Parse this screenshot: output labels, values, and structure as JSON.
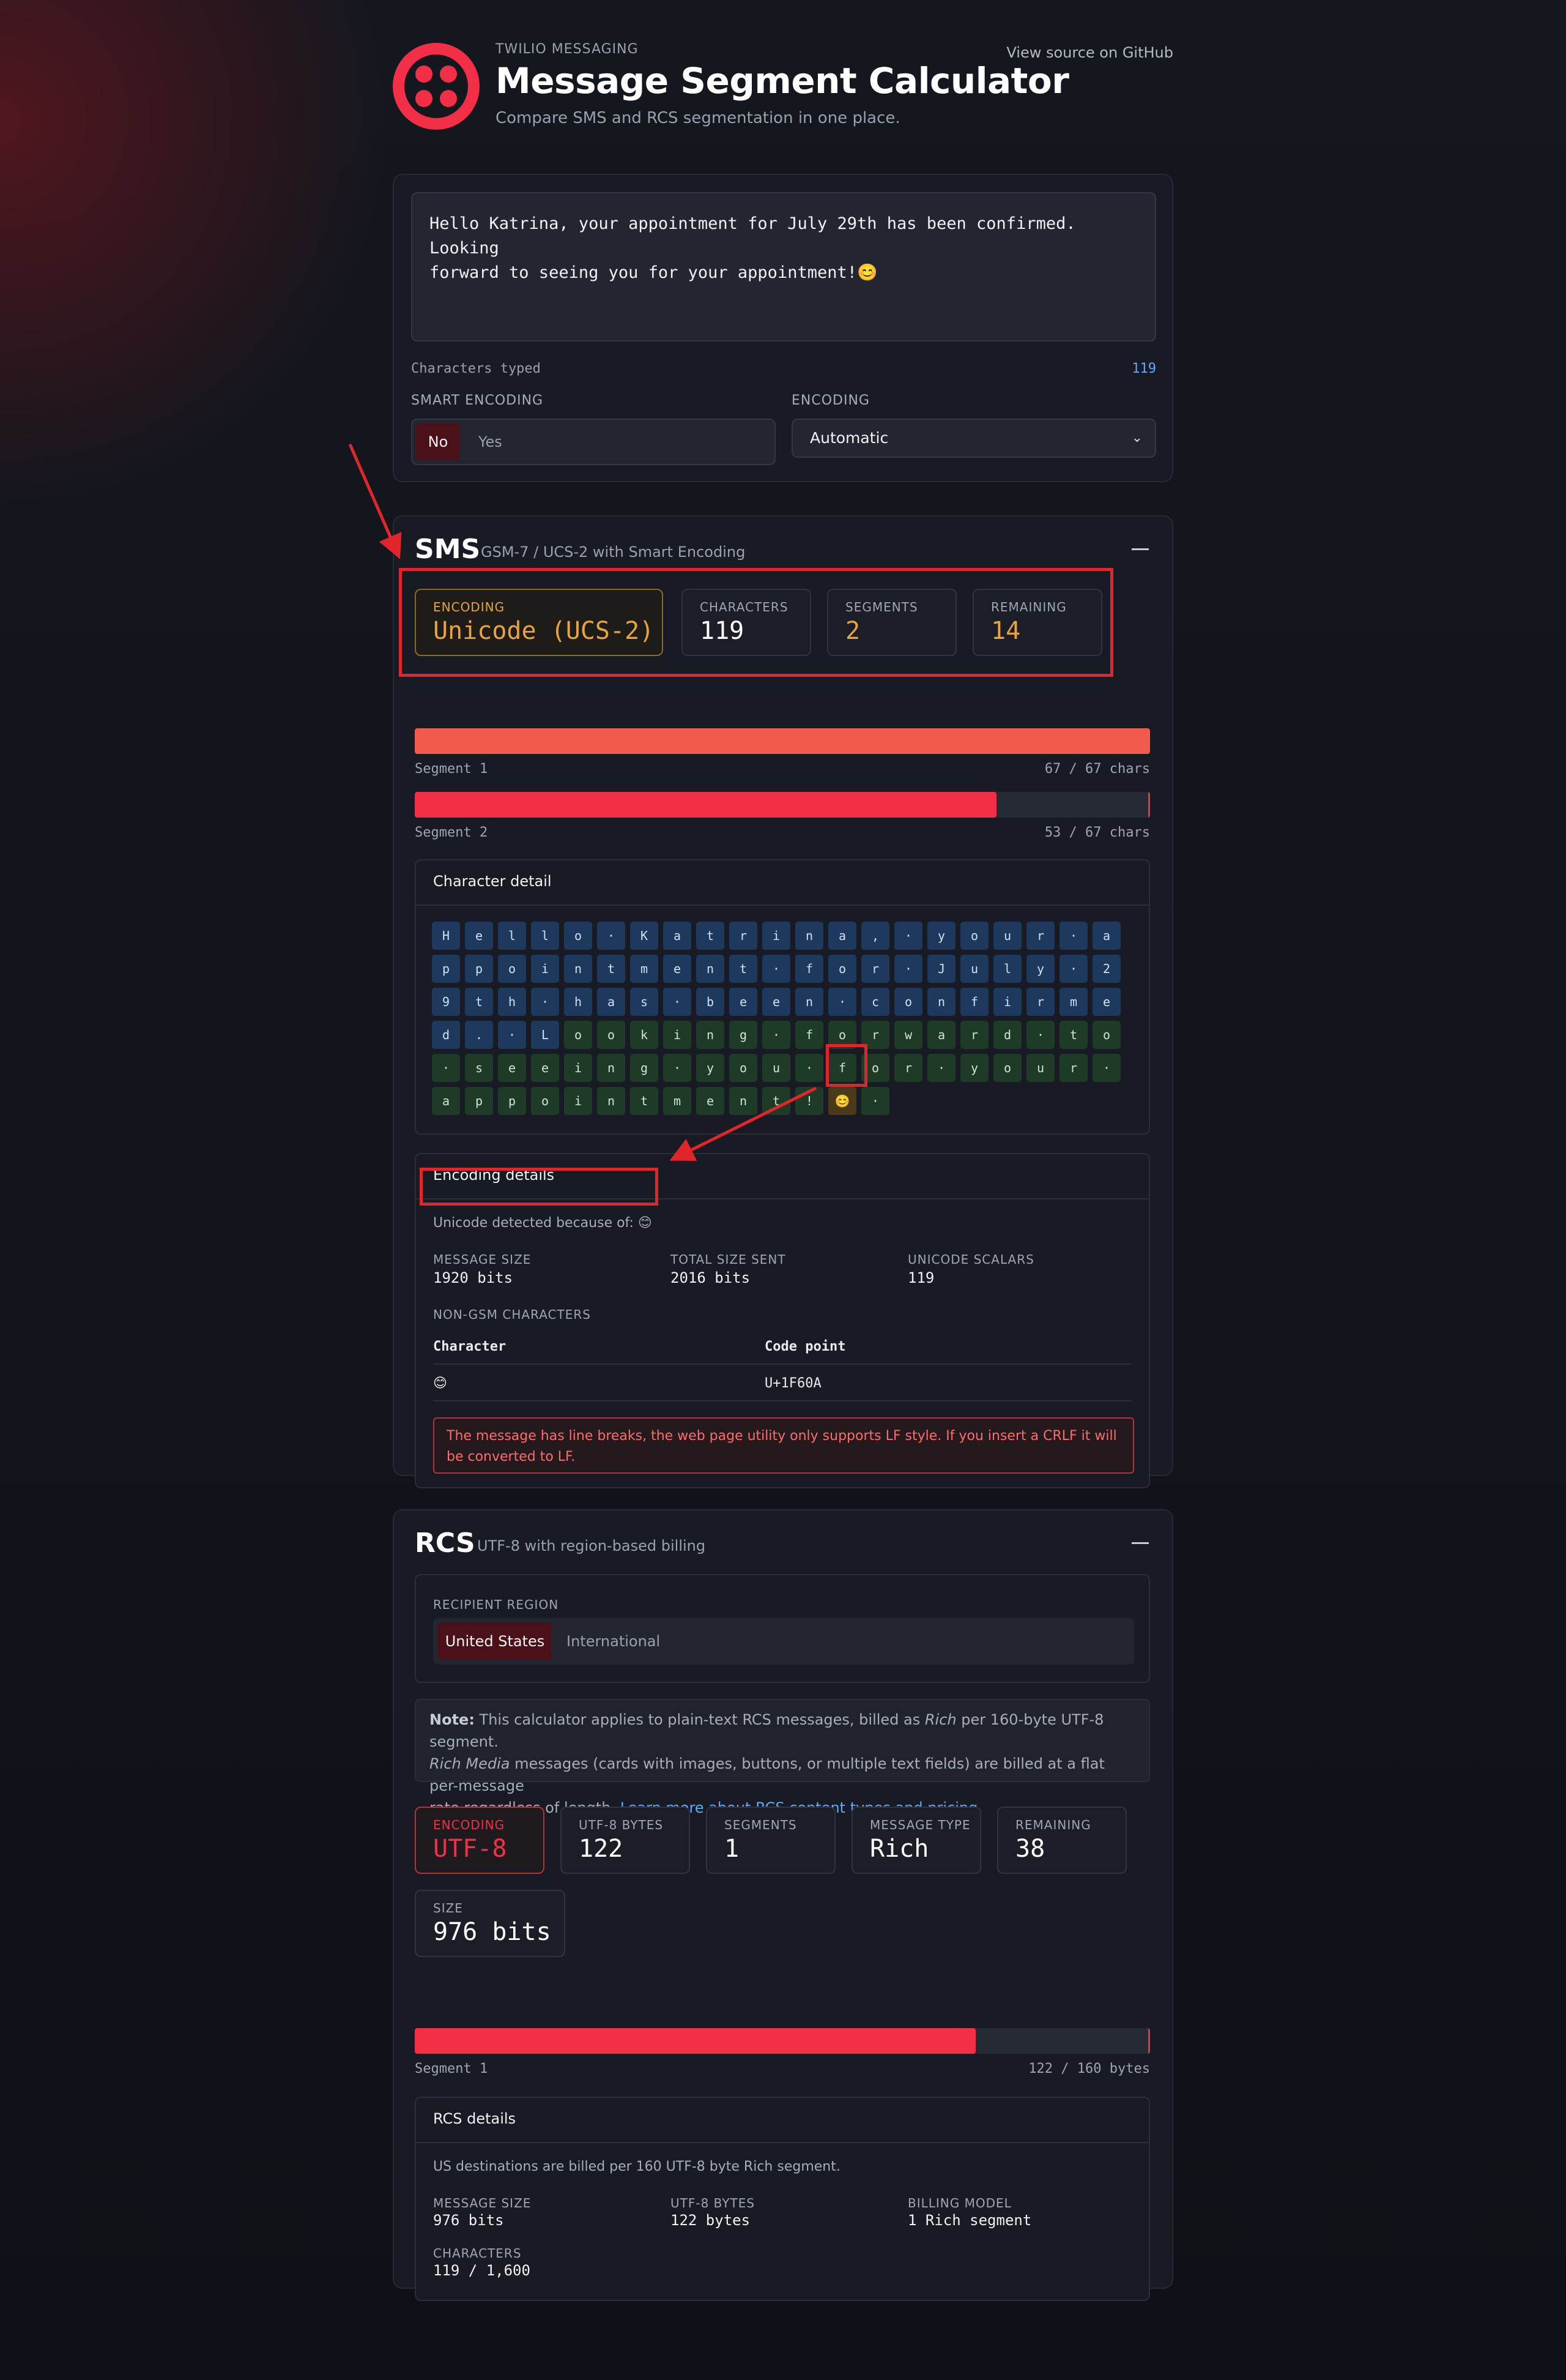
{
  "header": {
    "eyebrow": "TWILIO MESSAGING",
    "title": "Message Segment Calculator",
    "subtitle": "Compare SMS and RCS segmentation in one place.",
    "github_link": "View source on GitHub"
  },
  "input": {
    "message_line1": "Hello Katrina, your appointment for July 29th has been confirmed. Looking",
    "message_line2": "forward to seeing you for your appointment!😊",
    "chars_typed_label": "Characters typed",
    "chars_typed_value": "119",
    "smart_encoding_label": "SMART ENCODING",
    "smart_no": "No",
    "smart_yes": "Yes",
    "encoding_label": "ENCODING",
    "encoding_value": "Automatic"
  },
  "sms": {
    "title": "SMS",
    "subtitle": "GSM-7 / UCS-2 with Smart Encoding",
    "stats": {
      "encoding_k": "ENCODING",
      "encoding_v": "Unicode (UCS-2)",
      "characters_k": "CHARACTERS",
      "characters_v": "119",
      "segments_k": "SEGMENTS",
      "segments_v": "2",
      "remaining_k": "REMAINING",
      "remaining_v": "14"
    },
    "segments": [
      {
        "label": "Segment 1",
        "count": "67 / 67 chars",
        "fill_fraction": 1.0
      },
      {
        "label": "Segment 2",
        "count": "53 / 67 chars",
        "fill_fraction": 0.791
      }
    ],
    "char_detail_title": "Character detail",
    "char_rows": [
      [
        "H",
        "e",
        "l",
        "l",
        "o",
        "·",
        "K",
        "a",
        "t",
        "r",
        "i",
        "n",
        "a",
        ",",
        "·",
        "y",
        "o",
        "u",
        "r",
        "·",
        "a"
      ],
      [
        "p",
        "p",
        "o",
        "i",
        "n",
        "t",
        "m",
        "e",
        "n",
        "t",
        "·",
        "f",
        "o",
        "r",
        "·",
        "J",
        "u",
        "l",
        "y",
        "·",
        "2"
      ],
      [
        "9",
        "t",
        "h",
        "·",
        "h",
        "a",
        "s",
        "·",
        "b",
        "e",
        "e",
        "n",
        "·",
        "c",
        "o",
        "n",
        "f",
        "i",
        "r",
        "m",
        "e"
      ],
      [
        "d",
        ".",
        "·",
        "L",
        "o",
        "o",
        "k",
        "i",
        "n",
        "g",
        "·",
        "f",
        "o",
        "r",
        "w",
        "a",
        "r",
        "d",
        "·",
        "t",
        "o"
      ],
      [
        "·",
        "s",
        "e",
        "e",
        "i",
        "n",
        "g",
        "·",
        "y",
        "o",
        "u",
        "·",
        "f",
        "o",
        "r",
        "·",
        "y",
        "o",
        "u",
        "r",
        "·"
      ],
      [
        "a",
        "p",
        "p",
        "o",
        "i",
        "n",
        "t",
        "m",
        "e",
        "n",
        "t",
        "!",
        "😊",
        "·"
      ]
    ],
    "encoding_details_title": "Encoding details",
    "unicode_detected": "Unicode detected because of: 😊",
    "message_size_k": "MESSAGE SIZE",
    "message_size_v": "1920 bits",
    "total_size_k": "TOTAL SIZE SENT",
    "total_size_v": "2016 bits",
    "unicode_scalars_k": "UNICODE SCALARS",
    "unicode_scalars_v": "119",
    "non_gsm_k": "NON-GSM CHARACTERS",
    "table_headers": [
      "Character",
      "Code point"
    ],
    "table_rows": [
      [
        "😊",
        "U+1F60A"
      ]
    ],
    "warning": "The message has line breaks, the web page utility only supports LF style. If you insert a CRLF it will be converted to LF."
  },
  "rcs": {
    "title": "RCS",
    "subtitle": "UTF-8 with region-based billing",
    "region_label": "RECIPIENT REGION",
    "region_us": "United States",
    "region_intl": "International",
    "note_bold": "Note:",
    "note_1": " This calculator applies to plain-text RCS messages, billed as ",
    "note_rich": "Rich",
    "note_2": " per 160-byte UTF-8 segment.",
    "note_rich_media": "Rich Media",
    "note_3": " messages (cards with images, buttons, or multiple text fields) are billed at a flat per-message",
    "note_4": "rate regardless of length. ",
    "note_link": "Learn more about RCS content types and pricing",
    "note_end": ".",
    "stats": {
      "encoding_k": "ENCODING",
      "encoding_v": "UTF-8",
      "bytes_k": "UTF-8 BYTES",
      "bytes_v": "122",
      "segments_k": "SEGMENTS",
      "segments_v": "1",
      "type_k": "MESSAGE TYPE",
      "type_v": "Rich",
      "remaining_k": "REMAINING",
      "remaining_v": "38",
      "size_k": "SIZE",
      "size_v": "976 bits"
    },
    "segment": {
      "label": "Segment 1",
      "count": "122 / 160 bytes",
      "fill_fraction": 0.7625
    },
    "details_title": "RCS details",
    "details_desc": "US destinations are billed per 160 UTF-8 byte Rich segment.",
    "message_size_k": "MESSAGE SIZE",
    "message_size_v": "976 bits",
    "bytes_k": "UTF-8 BYTES",
    "bytes_v": "122 bytes",
    "billing_k": "BILLING MODEL",
    "billing_v": "1 Rich segment",
    "characters_k": "CHARACTERS",
    "characters_v": "119 / 1,600"
  },
  "colors": {
    "accent": "#f22f46",
    "ucs2": "#e8a33a",
    "link": "#5ea8ff",
    "annotation": "#e0262b"
  }
}
